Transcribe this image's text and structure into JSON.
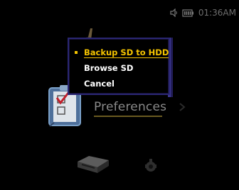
{
  "status_bar": {
    "time": "01:36AM",
    "speaker_icon": "speaker-icon",
    "battery_icon": "battery-icon"
  },
  "home": {
    "focused_label": "Preferences"
  },
  "popup": {
    "items": [
      {
        "label": "Backup SD to HDD",
        "selected": true
      },
      {
        "label": "Browse SD",
        "selected": false
      },
      {
        "label": "Cancel",
        "selected": false
      }
    ]
  },
  "colors": {
    "selection": "#f5c400",
    "popup_border": "#2a2673",
    "text": "#ffffff",
    "background": "#000000"
  }
}
